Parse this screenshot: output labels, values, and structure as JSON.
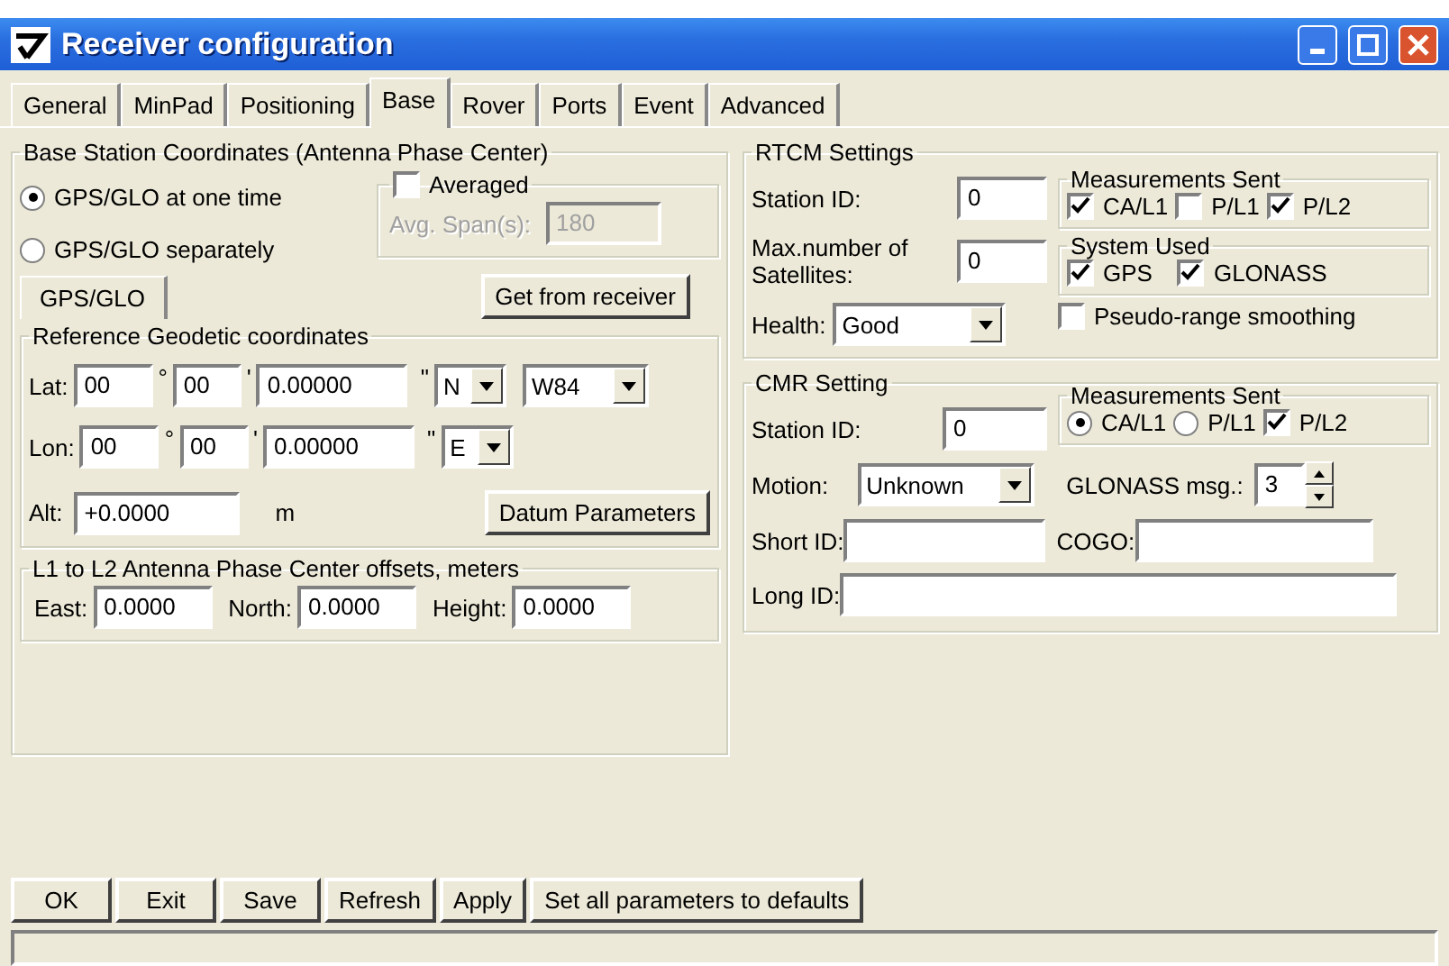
{
  "window": {
    "title": "Receiver configuration"
  },
  "tabs": [
    {
      "label": "General",
      "selected": false
    },
    {
      "label": "MinPad",
      "selected": false
    },
    {
      "label": "Positioning",
      "selected": false
    },
    {
      "label": "Base",
      "selected": true
    },
    {
      "label": "Rover",
      "selected": false
    },
    {
      "label": "Ports",
      "selected": false
    },
    {
      "label": "Event",
      "selected": false
    },
    {
      "label": "Advanced",
      "selected": false
    }
  ],
  "base_station": {
    "title": "Base Station Coordinates (Antenna Phase Center)",
    "modes": [
      {
        "label": "GPS/GLO at one time",
        "selected": true
      },
      {
        "label": "GPS/GLO separately",
        "selected": false
      }
    ],
    "averaged": {
      "label": "Averaged",
      "checked": false,
      "span_label": "Avg. Span(s):",
      "span_value": "180",
      "disabled": true
    },
    "subtab": {
      "label": "GPS/GLO",
      "selected": true
    },
    "get_button": "Get from receiver",
    "reference": {
      "title": "Reference Geodetic coordinates",
      "rows": [
        {
          "label": "Lat:",
          "deg": "00",
          "deg_mark": "°",
          "min": "00",
          "min_mark": "'",
          "sec": "0.00000",
          "sec_mark": "\"",
          "hemisphere": "N",
          "datum": "W84"
        },
        {
          "label": "Lon:",
          "deg": "00",
          "deg_mark": "°",
          "min": "00",
          "min_mark": "'",
          "sec": "0.00000",
          "sec_mark": "\"",
          "hemisphere": "E"
        }
      ],
      "alt": {
        "label": "Alt:",
        "value": "+0.0000",
        "unit": "m"
      },
      "datum_button": "Datum Parameters"
    },
    "offsets": {
      "title": "L1 to L2 Antenna Phase Center offsets, meters",
      "fields": [
        {
          "label": "East:",
          "value": "0.0000"
        },
        {
          "label": "North:",
          "value": "0.0000"
        },
        {
          "label": "Height:",
          "value": "0.0000"
        }
      ]
    }
  },
  "rtcm": {
    "title": "RTCM Settings",
    "station_id": {
      "label": "Station ID:",
      "value": "0"
    },
    "max_sats": {
      "label": "Max.number of Satellites:",
      "value": "0"
    },
    "health": {
      "label": "Health:",
      "value": "Good"
    },
    "measurements": {
      "title": "Measurements Sent",
      "items": [
        {
          "kind": "checkbox",
          "label": "CA/L1",
          "checked": true
        },
        {
          "kind": "checkbox",
          "label": "P/L1",
          "checked": false
        },
        {
          "kind": "checkbox",
          "label": "P/L2",
          "checked": true
        }
      ]
    },
    "system": {
      "title": "System Used",
      "items": [
        {
          "kind": "checkbox",
          "label": "GPS",
          "checked": true
        },
        {
          "kind": "checkbox",
          "label": "GLONASS",
          "checked": true
        }
      ]
    },
    "smoothing": {
      "label": "Pseudo-range smoothing",
      "checked": false
    }
  },
  "cmr": {
    "title": "CMR Setting",
    "station_id": {
      "label": "Station ID:",
      "value": "0"
    },
    "measurements": {
      "title": "Measurements Sent",
      "items": [
        {
          "kind": "radio",
          "label": "CA/L1",
          "checked": true
        },
        {
          "kind": "radio",
          "label": "P/L1",
          "checked": false
        },
        {
          "kind": "checkbox",
          "label": "P/L2",
          "checked": true
        }
      ]
    },
    "motion": {
      "label": "Motion:",
      "value": "Unknown"
    },
    "glonass_msg": {
      "label": "GLONASS msg.:",
      "value": "3"
    },
    "short_id": {
      "label": "Short ID:"
    },
    "cogo": {
      "label": "COGO:"
    },
    "long_id": {
      "label": "Long ID:"
    }
  },
  "buttons": [
    "OK",
    "Exit",
    "Save",
    "Refresh",
    "Apply",
    "Set all parameters to defaults"
  ]
}
